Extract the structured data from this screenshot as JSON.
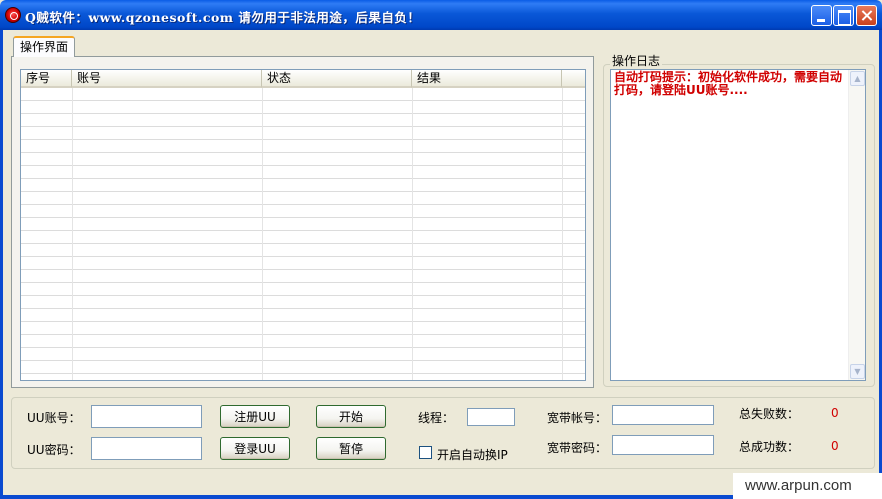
{
  "window": {
    "title": "Q贼软件：www.qzonesoft.com    请勿用于非法用途，后果自负！"
  },
  "tab": {
    "label": "操作界面"
  },
  "table": {
    "columns": [
      "序号",
      "账号",
      "状态",
      "结果"
    ],
    "rows": []
  },
  "log": {
    "legend": "操作日志",
    "message": "自动打码提示：初始化软件成功，需要自动打码，请登陆UU账号...."
  },
  "form": {
    "uu_account_label": "UU账号：",
    "uu_account_value": "",
    "uu_password_label": "UU密码：",
    "uu_password_value": "",
    "register_btn": "注册UU",
    "login_btn": "登录UU",
    "start_btn": "开始",
    "pause_btn": "暂停",
    "threads_label": "线程：",
    "threads_value": "",
    "auto_ip_label": "开启自动换IP",
    "broadband_account_label": "宽带帐号：",
    "broadband_account_value": "",
    "broadband_password_label": "宽带密码：",
    "broadband_password_value": "",
    "total_fail_label": "总失败数：",
    "total_fail_value": "0",
    "total_success_label": "总成功数：",
    "total_success_value": "0"
  },
  "watermark": {
    "text": "www.arpun.com"
  },
  "colors": {
    "titlebar": "#0a58d8",
    "log_text": "#d00000",
    "count_text": "#d00000",
    "window_bg": "#ece9d8"
  }
}
